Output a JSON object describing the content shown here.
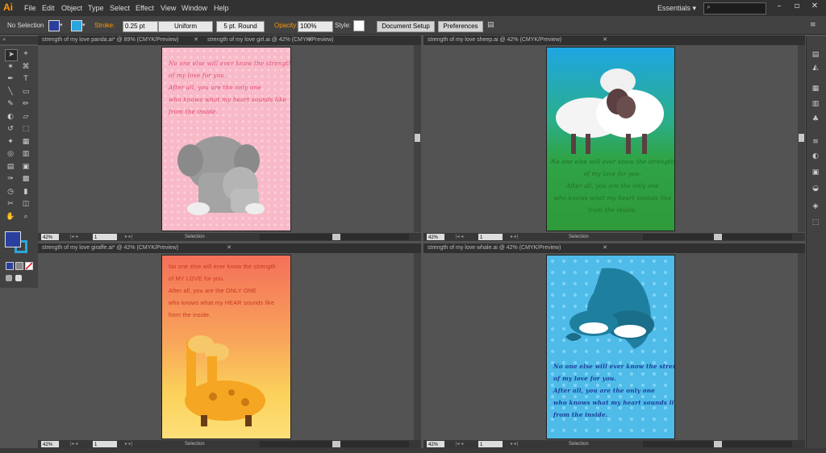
{
  "menubar": {
    "logo": "Ai",
    "items": [
      "File",
      "Edit",
      "Object",
      "Type",
      "Select",
      "Effect",
      "View",
      "Window",
      "Help"
    ],
    "workspace": "Essentials",
    "workspace_icon": "chevron-down-icon"
  },
  "control_bar": {
    "selection": "No Selection",
    "stroke_label": "Stroke:",
    "stroke_value": "0.25 pt",
    "profile": "Uniform",
    "brush": "5 pt. Round",
    "opacity_label": "Opacity:",
    "opacity_value": "100%",
    "style_label": "Style:",
    "document_setup": "Document Setup",
    "preferences": "Preferences",
    "fill_color": "#2b3f9e",
    "stroke_color": "#2aa6df"
  },
  "colors": {
    "accent": "#ff9a00",
    "fill": "#2b3f9e",
    "stroke": "#2aa6df"
  },
  "documents": [
    {
      "tab": "strength of my love panda.ai* @ 89% (CMYK/Preview)",
      "tab2": "strength of my love girl.ai @ 42% (CMYK/Preview)",
      "zoom": "42%",
      "page": "1",
      "status": "Selection",
      "poem": [
        "No one else will ever know the strength",
        "of my love for you.",
        "After all, you are the only one",
        "who knows what my heart sounds like",
        "from the inside."
      ]
    },
    {
      "tab": "strength of my love sheep.ai @ 42% (CMYK/Preview)",
      "zoom": "42%",
      "page": "1",
      "status": "Selection",
      "poem": [
        "No one else will ever know the strength",
        "of my love for you.",
        "After all, you are the only one",
        "who knows what my heart sounds like",
        "from the inside."
      ]
    },
    {
      "tab": "strength of my love giraffe.ai* @ 42% (CMYK/Preview)",
      "zoom": "42%",
      "page": "1",
      "status": "Selection",
      "poem": [
        "No one else will ever know the strength",
        "of MY LOVE for you.",
        "After all, you are the ONLY ONE",
        "who knows what my HEAR sounds like",
        "from the inside."
      ]
    },
    {
      "tab": "strength of my love whale.ai @ 42% (CMYK/Preview)",
      "zoom": "42%",
      "page": "1",
      "status": "Selection",
      "poem": [
        "No one else will ever know the strength",
        "of my love for you.",
        "After all, you are the only one",
        "who knows what my heart sounds like",
        "from the inside."
      ]
    }
  ]
}
